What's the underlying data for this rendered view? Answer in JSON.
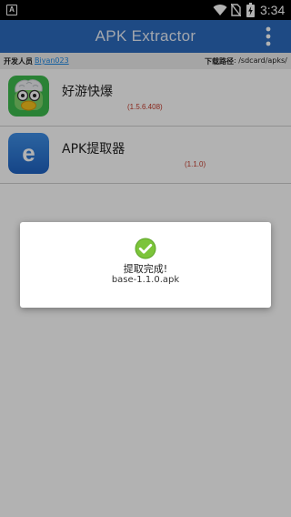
{
  "status_bar": {
    "notification_icon": "A",
    "time": "3:34",
    "icons": [
      "notification-a-icon",
      "wifi-icon",
      "no-sim-icon",
      "battery-charging-icon"
    ]
  },
  "app_bar": {
    "title": "APK Extractor",
    "menu_icon": "overflow-menu-icon",
    "background_color": "#2b6bbd"
  },
  "info_bar": {
    "developer_label": "开发人员",
    "developer_name": "Biyan023",
    "path_label": "下载路径",
    "path_value": ": /sdcard/apks/"
  },
  "apps": [
    {
      "name": "好游快爆",
      "version": "(1.5.6.408)",
      "icon": "haoyou-kuaibao-app-icon"
    },
    {
      "name": "APK提取器",
      "version": "(1.1.0)",
      "icon": "apk-extractor-app-icon"
    }
  ],
  "dialog": {
    "icon": "success-check-icon",
    "title": "提取完成!",
    "file_name": "base-1.1.0.apk",
    "accent_color": "#7cc43a"
  }
}
